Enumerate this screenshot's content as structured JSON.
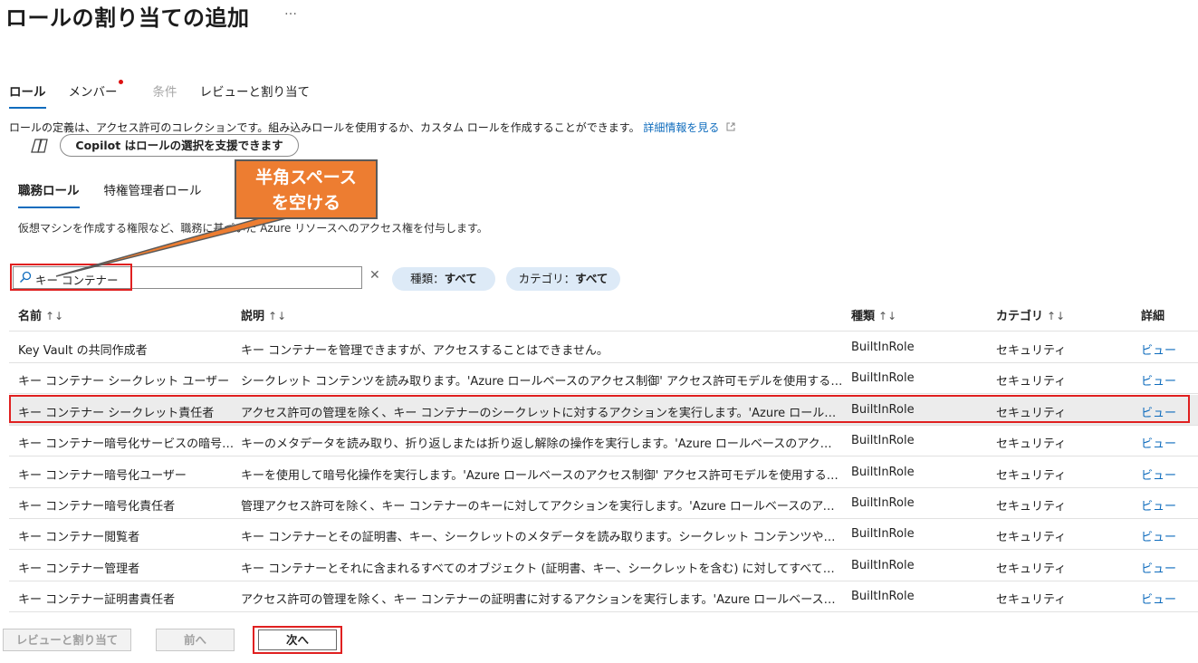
{
  "page": {
    "title": "ロールの割り当ての追加",
    "more": "…"
  },
  "tabs": [
    {
      "label": "ロール"
    },
    {
      "label": "メンバー"
    },
    {
      "label": "条件"
    },
    {
      "label": "レビューと割り当て"
    }
  ],
  "description": {
    "text": "ロールの定義は、アクセス許可のコレクションです。組み込みロールを使用するか、カスタム ロールを作成することができます。",
    "link": "詳細情報を見る"
  },
  "copilot": {
    "button_label": "Copilot はロールの選択を支援できます"
  },
  "subtabs": [
    {
      "label": "職務ロール"
    },
    {
      "label": "特権管理者ロール"
    }
  ],
  "subdescription": "仮想マシンを作成する権限など、職務に基づいた Azure リソースへのアクセス権を付与します。",
  "search": {
    "value": "キー コンテナー"
  },
  "filters": {
    "type": {
      "label": "種類：",
      "value": "すべて"
    },
    "category": {
      "label": "カテゴリ：",
      "value": "すべて"
    }
  },
  "table": {
    "headers": {
      "name": "名前",
      "description": "説明",
      "type": "種類",
      "category": "カテゴリ",
      "details": "詳細"
    },
    "sort_icon": "↑↓",
    "rows": [
      {
        "name": "Key Vault の共同作成者",
        "description": "キー コンテナーを管理できますが、アクセスすることはできません。",
        "type": "BuiltInRole",
        "category": "セキュリティ",
        "details": "ビュー"
      },
      {
        "name": "キー コンテナー シークレット ユーザー",
        "description": "シークレット コンテンツを読み取ります。'Azure ロールベースのアクセス制御' アクセス許可モデルを使用するキー コンテナーでのみ機能します。",
        "type": "BuiltInRole",
        "category": "セキュリティ",
        "details": "ビュー"
      },
      {
        "name": "キー コンテナー シークレット責任者",
        "description": "アクセス許可の管理を除く、キー コンテナーのシークレットに対するアクションを実行します。'Azure ロールベースのアクセス制御' アクセス許可モデルを使用するキー コンテナーでのみ機能します。",
        "type": "BuiltInRole",
        "category": "セキュリティ",
        "details": "ビュー"
      },
      {
        "name": "キー コンテナー暗号化サービスの暗号化ユーザー",
        "description": "キーのメタデータを読み取り、折り返しまたは折り返し解除の操作を実行します。'Azure ロールベースのアクセス制御' アクセス許可モデルを使用するキー コンテナーでのみ機能します。",
        "type": "BuiltInRole",
        "category": "セキュリティ",
        "details": "ビュー"
      },
      {
        "name": "キー コンテナー暗号化ユーザー",
        "description": "キーを使用して暗号化操作を実行します。'Azure ロールベースのアクセス制御' アクセス許可モデルを使用するキー コンテナーでのみ機能します。",
        "type": "BuiltInRole",
        "category": "セキュリティ",
        "details": "ビュー"
      },
      {
        "name": "キー コンテナー暗号化責任者",
        "description": "管理アクセス許可を除く、キー コンテナーのキーに対してアクションを実行します。'Azure ロールベースのアクセス制御' アクセス許可モデルを使用するキー コンテナーでのみ機能します。",
        "type": "BuiltInRole",
        "category": "セキュリティ",
        "details": "ビュー"
      },
      {
        "name": "キー コンテナー閲覧者",
        "description": "キー コンテナーとその証明書、キー、シークレットのメタデータを読み取ります。シークレット コンテンツやキー マテリアルなどの機密値は読み取ることができません。",
        "type": "BuiltInRole",
        "category": "セキュリティ",
        "details": "ビュー"
      },
      {
        "name": "キー コンテナー管理者",
        "description": "キー コンテナーとそれに含まれるすべてのオブジェクト (証明書、キー、シークレットを含む) に対してすべてのデータ プレーン操作を実行します。",
        "type": "BuiltInRole",
        "category": "セキュリティ",
        "details": "ビュー"
      },
      {
        "name": "キー コンテナー証明書責任者",
        "description": "アクセス許可の管理を除く、キー コンテナーの証明書に対するアクションを実行します。'Azure ロールベースのアクセス制御' アクセス許可モデルを使用するキー コンテナーでのみ機能します。",
        "type": "BuiltInRole",
        "category": "セキュリティ",
        "details": "ビュー"
      }
    ]
  },
  "footer": {
    "review_label": "レビューと割り当て",
    "prev_label": "前へ",
    "next_label": "次へ"
  },
  "callout": {
    "line1": "半角スペース",
    "line2": "を空ける"
  },
  "colors": {
    "accent": "#0f6cbd",
    "highlight_border": "#e02020",
    "callout_fill": "#ed7d31",
    "pill_bg": "#ddeaf7",
    "selected_row": "#ececec"
  }
}
